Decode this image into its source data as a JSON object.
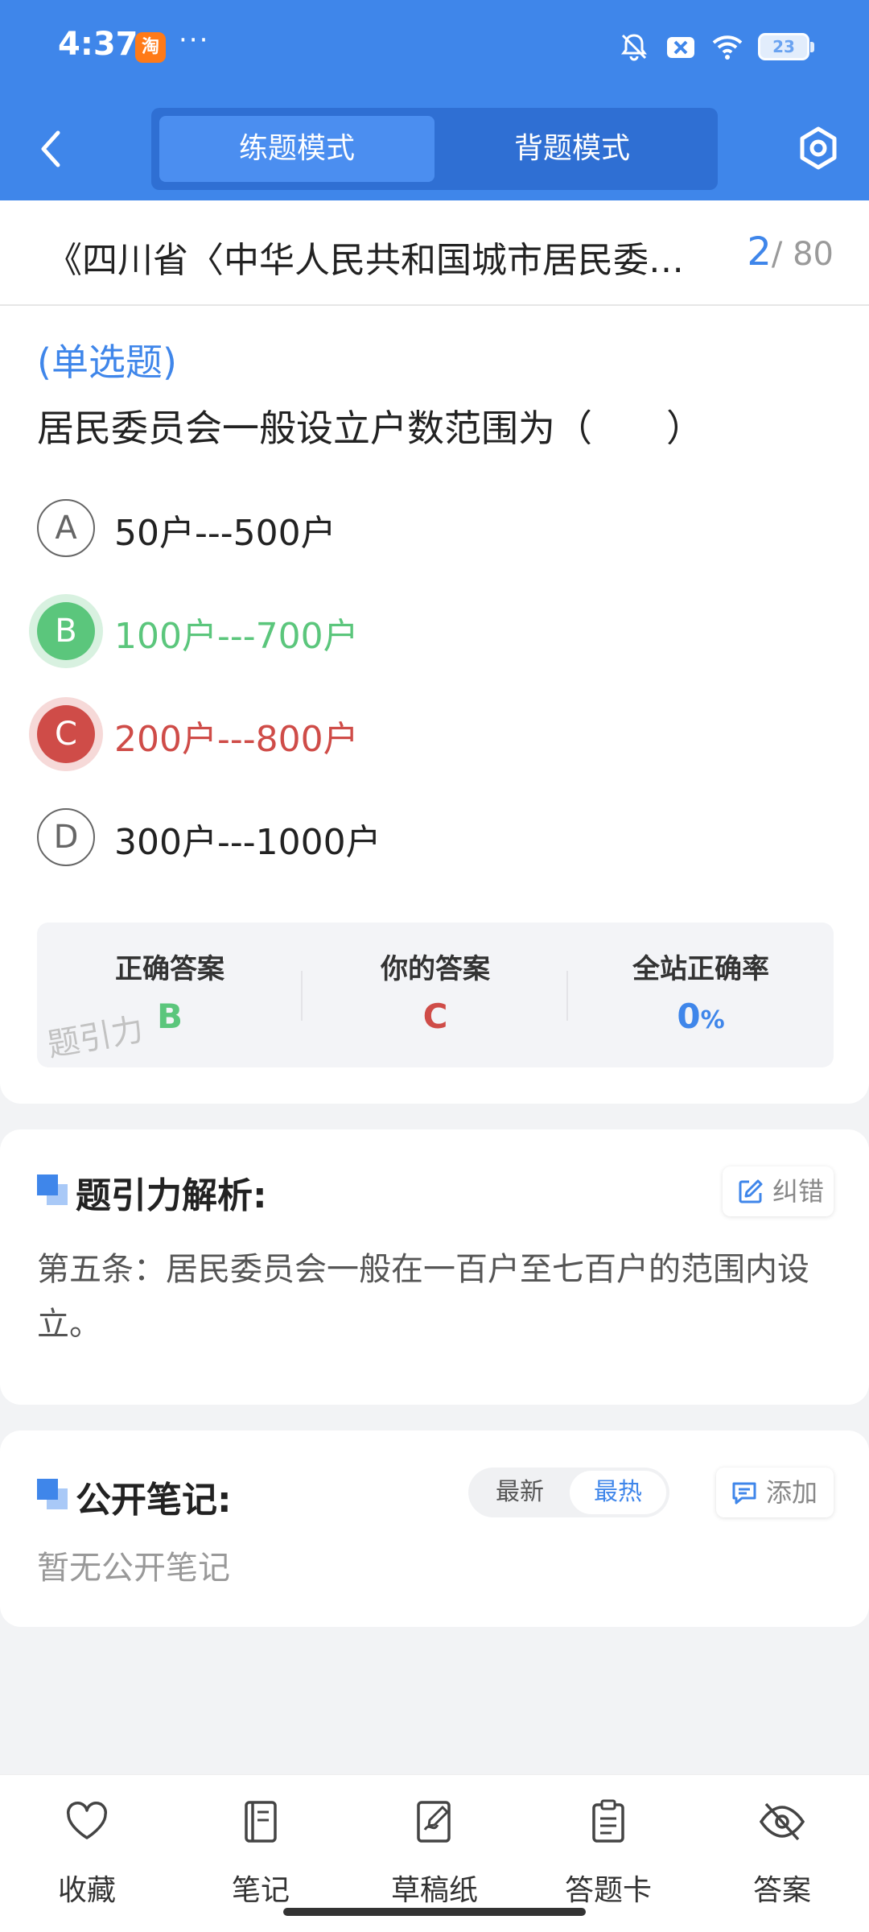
{
  "status_bar": {
    "time": "4:37",
    "taobao_icon": "淘",
    "dots": "···",
    "battery": "23"
  },
  "header": {
    "tabs": [
      {
        "label": "练题模式",
        "active": true
      },
      {
        "label": "背题模式",
        "active": false
      }
    ]
  },
  "question": {
    "title": "《四川省〈中华人民共和国城市居民委…",
    "current": "2",
    "total": "/ 80",
    "type": "(单选题)",
    "text": "居民委员会一般设立户数范围为（　　）",
    "options": [
      {
        "letter": "A",
        "text": "50户---500户",
        "state": "normal"
      },
      {
        "letter": "B",
        "text": "100户---700户",
        "state": "correct"
      },
      {
        "letter": "C",
        "text": "200户---800户",
        "state": "wrong"
      },
      {
        "letter": "D",
        "text": "300户---1000户",
        "state": "normal"
      }
    ]
  },
  "answer": {
    "correct_label": "正确答案",
    "correct_value": "B",
    "yours_label": "你的答案",
    "yours_value": "C",
    "rate_label": "全站正确率",
    "rate_value": "0",
    "rate_unit": "%",
    "watermark": "题引力"
  },
  "analysis": {
    "title": "题引力解析:",
    "correct_button": "纠错",
    "text": "第五条：居民委员会一般在一百户至七百户的范围内设立。"
  },
  "notes": {
    "title": "公开笔记:",
    "sort_latest": "最新",
    "sort_hot": "最热",
    "add_button": "添加",
    "empty": "暂无公开笔记"
  },
  "bottom_nav": {
    "items": [
      {
        "label": "收藏",
        "icon": "heart-icon"
      },
      {
        "label": "笔记",
        "icon": "notebook-icon"
      },
      {
        "label": "草稿纸",
        "icon": "draft-icon"
      },
      {
        "label": "答题卡",
        "icon": "clipboard-icon"
      },
      {
        "label": "答案",
        "icon": "eye-off-icon"
      }
    ]
  },
  "colors": {
    "primary": "#3f86ea",
    "correct": "#5bc67c",
    "wrong": "#cf4c48"
  }
}
